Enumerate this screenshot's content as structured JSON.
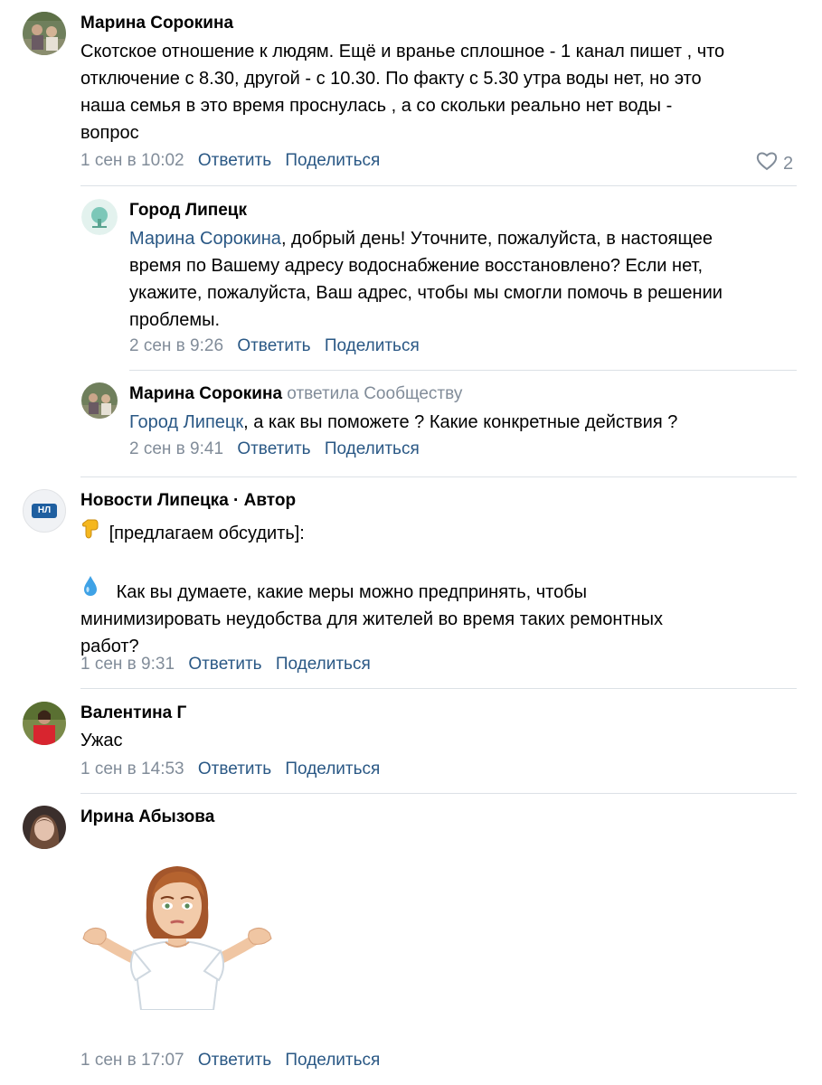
{
  "comments": [
    {
      "author": "Марина Сорокина",
      "text_lines": [
        "Скотское отношение к людям. Ещё и вранье сплошное - 1 канал пишет , что",
        "отключение с 8.30, другой - с 10.30. По факту с 5.30 утра воды нет, но это",
        "наша семья в это время проснулась , а со скольки реально нет воды -",
        "вопрос"
      ],
      "date": "1 сен в 10:02",
      "reply_label": "Ответить",
      "share_label": "Поделиться",
      "likes": "2"
    },
    {
      "author": "Город Липецк",
      "mention": "Марина Сорокина",
      "text_lines": [
        ", добрый день! Уточните, пожалуйста, в настоящее",
        "время по Вашему адресу водоснабжение восстановлено? Если нет,",
        "укажите, пожалуйста, Ваш адрес, чтобы мы смогли помочь в решении",
        "проблемы."
      ],
      "date": "2 сен в 9:26",
      "reply_label": "Ответить",
      "share_label": "Поделиться"
    },
    {
      "author": "Марина Сорокина",
      "author_suffix": "ответила Сообществу",
      "mention": "Город Липецк",
      "text_lines": [
        ", а как вы поможете ? Какие конкретные действия ?"
      ],
      "date": "2 сен в 9:41",
      "reply_label": "Ответить",
      "share_label": "Поделиться"
    },
    {
      "author": "Новости Липецка · Автор",
      "avatar_text": "НЛ",
      "line1": "[предлагаем обсудить]:",
      "text_lines": [
        "Как вы думаете, какие меры можно предпринять, чтобы",
        "минимизировать неудобства для жителей во время таких ремонтных",
        "работ?"
      ],
      "date": "1 сен в 9:31",
      "reply_label": "Ответить",
      "share_label": "Поделиться"
    },
    {
      "author": "Валентина Г",
      "text_lines": [
        "Ужас"
      ],
      "date": "1 сен в 14:53",
      "reply_label": "Ответить",
      "share_label": "Поделиться"
    },
    {
      "author": "Ирина Абызова",
      "sticker": "shrugging-woman-sticker",
      "date": "1 сен в 17:07",
      "reply_label": "Ответить",
      "share_label": "Поделиться"
    }
  ],
  "icons": {
    "like": "heart-outline-icon",
    "point_down": "point-down-emoji-icon",
    "droplet": "droplet-emoji-icon"
  },
  "colors": {
    "link": "#2a5885",
    "meta": "#818c99",
    "divider": "#dce1e6"
  }
}
